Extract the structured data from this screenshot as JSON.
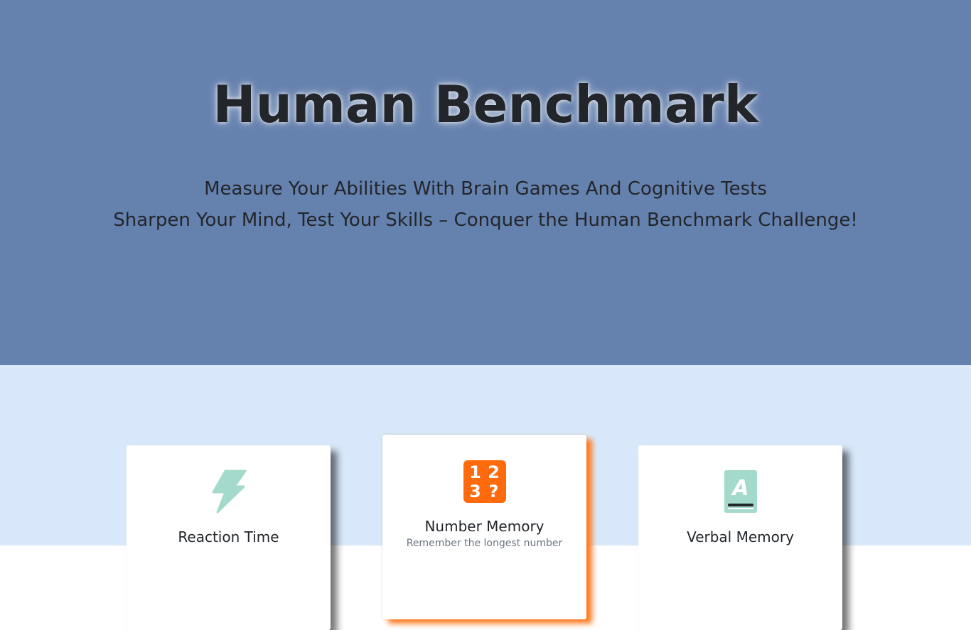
{
  "hero": {
    "title": "Human Benchmark",
    "subtitle_line1": "Measure Your Abilities With Brain Games And Cognitive Tests",
    "subtitle_line2": "Sharpen Your Mind, Test Your Skills – Conquer the Human Benchmark Challenge!"
  },
  "cards": [
    {
      "title": "Reaction Time",
      "description": "",
      "icon": "lightning-icon"
    },
    {
      "title": "Number Memory",
      "description": "Remember the longest number",
      "icon": "number-grid-icon",
      "icon_digits": [
        "1",
        "2",
        "3",
        "?"
      ]
    },
    {
      "title": "Verbal Memory",
      "description": "",
      "icon": "book-letter-icon"
    }
  ],
  "colors": {
    "hero_bg": "#6581ae",
    "lower_bg": "#d8e8fa",
    "accent_orange": "#ff6a0d",
    "icon_teal": "#a4dacb",
    "text_dark": "#22262b"
  }
}
